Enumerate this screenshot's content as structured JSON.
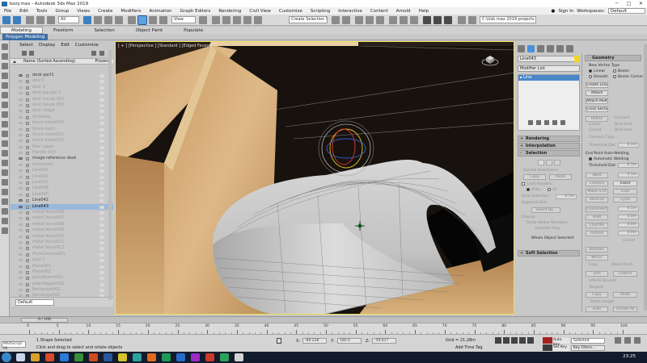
{
  "window": {
    "title": "kozy.max - Autodesk 3ds Max 2019",
    "min": "─",
    "max": "□",
    "close": "✕"
  },
  "menu": [
    "File",
    "Edit",
    "Tools",
    "Group",
    "Views",
    "Create",
    "Modifiers",
    "Animation",
    "Graph Editors",
    "Rendering",
    "Civil View",
    "Customize",
    "Scripting",
    "Interactive",
    "Content",
    "Arnold",
    "Help"
  ],
  "account": {
    "sign_in": "Sign In",
    "workspaces_label": "Workspaces:",
    "workspace": "Default"
  },
  "toolbar": {
    "selection_filter": "All",
    "view_dropdown": "View",
    "named_sets": "Create Selection Se",
    "path": "C:\\Usb max 2019 projects"
  },
  "ribbon_tabs": [
    "Modeling",
    "Freeform",
    "Selection",
    "Object Paint",
    "Populate"
  ],
  "polybar": "Polygon Modeling",
  "scene_explorer": {
    "tabs": [
      "Select",
      "Display",
      "Edit",
      "Customize"
    ],
    "header_name": "Name (Sorted Ascending)",
    "header_frozen": "Frozen",
    "rows": [
      {
        "name": "desk part1",
        "hidden": false
      },
      {
        "name": "door1",
        "hidden": true
      },
      {
        "name": "door 2",
        "hidden": true
      },
      {
        "name": "door garage 1",
        "hidden": true
      },
      {
        "name": "door house 001",
        "hidden": true
      },
      {
        "name": "door house 002",
        "hidden": true
      },
      {
        "name": "door shape",
        "hidden": true
      },
      {
        "name": "driveway",
        "hidden": true
      },
      {
        "name": "fence mesh006",
        "hidden": true
      },
      {
        "name": "fence main",
        "hidden": true
      },
      {
        "name": "fence mesh001",
        "hidden": true
      },
      {
        "name": "fence mesh002",
        "hidden": true
      },
      {
        "name": "floor upper",
        "hidden": true
      },
      {
        "name": "Handle 003",
        "hidden": true
      },
      {
        "name": "image reference desk",
        "hidden": false
      },
      {
        "name": "lamphole1",
        "hidden": true
      },
      {
        "name": "Line001",
        "hidden": true
      },
      {
        "name": "Line002",
        "hidden": true
      },
      {
        "name": "Line003",
        "hidden": true
      },
      {
        "name": "Line038",
        "hidden": true
      },
      {
        "name": "Line040",
        "hidden": true
      },
      {
        "name": "Line042",
        "hidden": false
      },
      {
        "name": "Line043",
        "hidden": false,
        "selected": true
      },
      {
        "name": "metal fence006",
        "hidden": true
      },
      {
        "name": "metal fence007",
        "hidden": true
      },
      {
        "name": "metal fence008",
        "hidden": true
      },
      {
        "name": "metal fence009",
        "hidden": true
      },
      {
        "name": "metal fence010",
        "hidden": true
      },
      {
        "name": "metal fence011",
        "hidden": true
      },
      {
        "name": "metal fence013",
        "hidden": true
      },
      {
        "name": "PhysCamera001",
        "hidden": true
      },
      {
        "name": "pipe 1",
        "hidden": true
      },
      {
        "name": "Plane001",
        "hidden": true
      },
      {
        "name": "Plane002",
        "hidden": true
      },
      {
        "name": "planeRoom001",
        "hidden": true
      },
      {
        "name": "pillarHapper001",
        "hidden": true
      },
      {
        "name": "Rectangle001",
        "hidden": true
      },
      {
        "name": "Rectangle002",
        "hidden": true
      }
    ],
    "layer": "Default"
  },
  "viewport": {
    "label": "[ + ] [Perspective ] [Standard ] [Edged Faces ]"
  },
  "command_panel": {
    "object_name": "Line043",
    "modifier_list": "Modifier List",
    "stack_item": "Line",
    "rollouts": {
      "rendering": "Rendering",
      "interpolation": "Interpolation",
      "selection": "Selection",
      "soft_selection": "Soft Selection"
    },
    "selection": {
      "named_selections": "Named Selections:",
      "copy": "Copy",
      "paste": "Paste",
      "lock_handles": "Lock Handles",
      "alike": "Alike",
      "all": "All",
      "area_selection": "Area Selection:",
      "area_value": "0.1m",
      "segment_end": "Segment End",
      "select_by": "Select By...",
      "display": "Display",
      "show_vertex_numbers": "Show Vertex Numbers",
      "selected_only": "Selected Only",
      "status": "Whole Object Selected"
    },
    "geometry": {
      "title": "Geometry",
      "new_vertex_type": "New Vertex Type",
      "linear": "Linear",
      "bezier": "Bezier",
      "smooth": "Smooth",
      "bezier_corner": "Bezier Corner",
      "create_line": "Create Line",
      "attach": "Attach",
      "attach_mult": "Attach Mult.",
      "cross_section": "Cross Section",
      "refine": "Refine",
      "connect": "Connect",
      "linear2": "Linear",
      "bind_first": "Bind First",
      "closed": "Closed",
      "bind_last": "Bind Last",
      "connect_copy": "Connect Copy",
      "threshold_dist": "Threshold Dist",
      "end_point_autowelding": "End Point Auto-Welding",
      "automatic_welding": "Automatic Welding",
      "weld": "Weld",
      "connect2": "Connect",
      "insert": "Insert",
      "make_first": "Make First",
      "fuse": "Fuse",
      "reverse": "Reverse",
      "cycle": "Cycle",
      "crossinsert": "CrossInsert",
      "fillet": "Fillet",
      "chamfer": "Chamfer",
      "outline": "Outline",
      "center": "Center",
      "boolean": "Boolean",
      "mirror": "Mirror",
      "copy": "Copy",
      "about_pivot": "About Pivot",
      "trim": "Trim",
      "extend": "Extend",
      "infinite_bounds": "Infinite Bounds",
      "tangent": "Tangent",
      "tcopy": "Copy",
      "tpaste": "Paste",
      "paste_length": "Paste Length",
      "hide": "Hide",
      "unhide_all": "Unhide All",
      "v_0": "0.0m",
      "v_01": "0.1m",
      "v_00": "0.0m"
    }
  },
  "timeline": {
    "frame": "0 / 100"
  },
  "ruler_labels": [
    "0",
    "5",
    "10",
    "15",
    "20",
    "25",
    "30",
    "35",
    "40",
    "45",
    "50",
    "55",
    "60",
    "65",
    "70",
    "75",
    "80",
    "85",
    "90",
    "95",
    "100"
  ],
  "status": {
    "maxscript": "MAXScript Mi",
    "shapes_selected": "1 Shape Selected",
    "prompt": "Click and drag to select and rotate objects",
    "x_label": "X:",
    "x": "-89.238",
    "y_label": "Y:",
    "y": "180.0",
    "z_label": "Z:",
    "z": "-59.617",
    "grid": "Grid = 21.28m",
    "add_time_tag": "Add Time Tag",
    "auto_key": "Auto Key",
    "set_key": "Set Key",
    "selected": "Selected",
    "key_filters": "Key Filters..."
  },
  "taskbar": {
    "clock": "23:25"
  }
}
